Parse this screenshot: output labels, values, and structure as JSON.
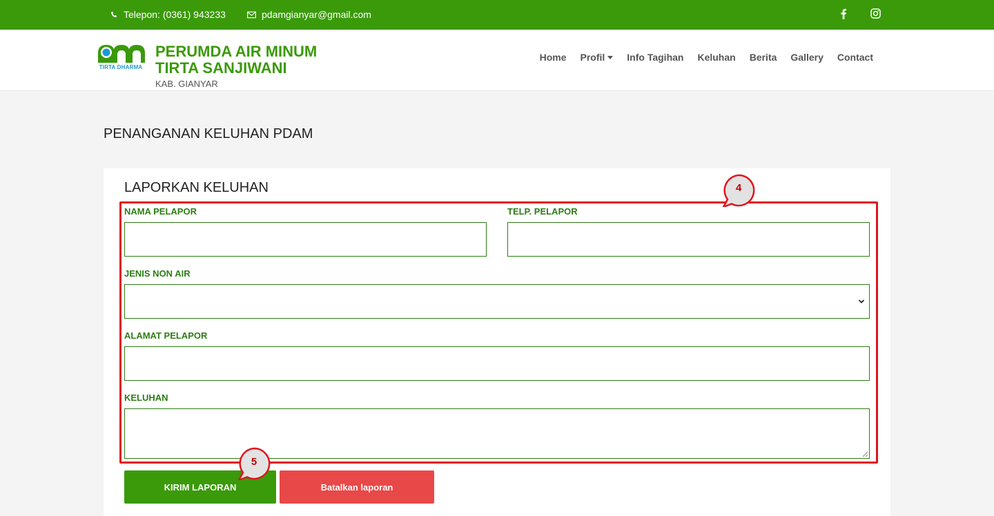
{
  "topbar": {
    "phone": "Telepon: (0361) 943233",
    "email": "pdamgianyar@gmail.com",
    "social": [
      "facebook-icon",
      "instagram-icon"
    ]
  },
  "header": {
    "logo_caption": "TIRTA DHARMA",
    "brand_line1": "PERUMDA AIR MINUM",
    "brand_line2": "TIRTA SANJIWANI",
    "brand_sub": "KAB. GIANYAR",
    "nav": [
      "Home",
      "Profil",
      "Info Tagihan",
      "Keluhan",
      "Berita",
      "Gallery",
      "Contact"
    ]
  },
  "page": {
    "title": "PENANGANAN KELUHAN PDAM"
  },
  "form": {
    "title": "LAPORKAN KELUHAN",
    "nama_label": "NAMA PELAPOR",
    "nama_value": "",
    "telp_label": "TELP. PELAPOR",
    "telp_value": "",
    "jenis_label": "JENIS NON AIR",
    "jenis_value": "",
    "alamat_label": "ALAMAT PELAPOR",
    "alamat_value": "",
    "keluhan_label": "KELUHAN",
    "keluhan_value": "",
    "submit_label": "KIRIM LAPORAN",
    "cancel_label": "Batalkan laporan"
  },
  "annotations": {
    "callout_4": "4",
    "callout_5": "5"
  },
  "colors": {
    "brand_green": "#3a9a0a",
    "label_green": "#2d7d14",
    "cancel_red": "#e84848",
    "highlight_red": "#e0141e"
  }
}
